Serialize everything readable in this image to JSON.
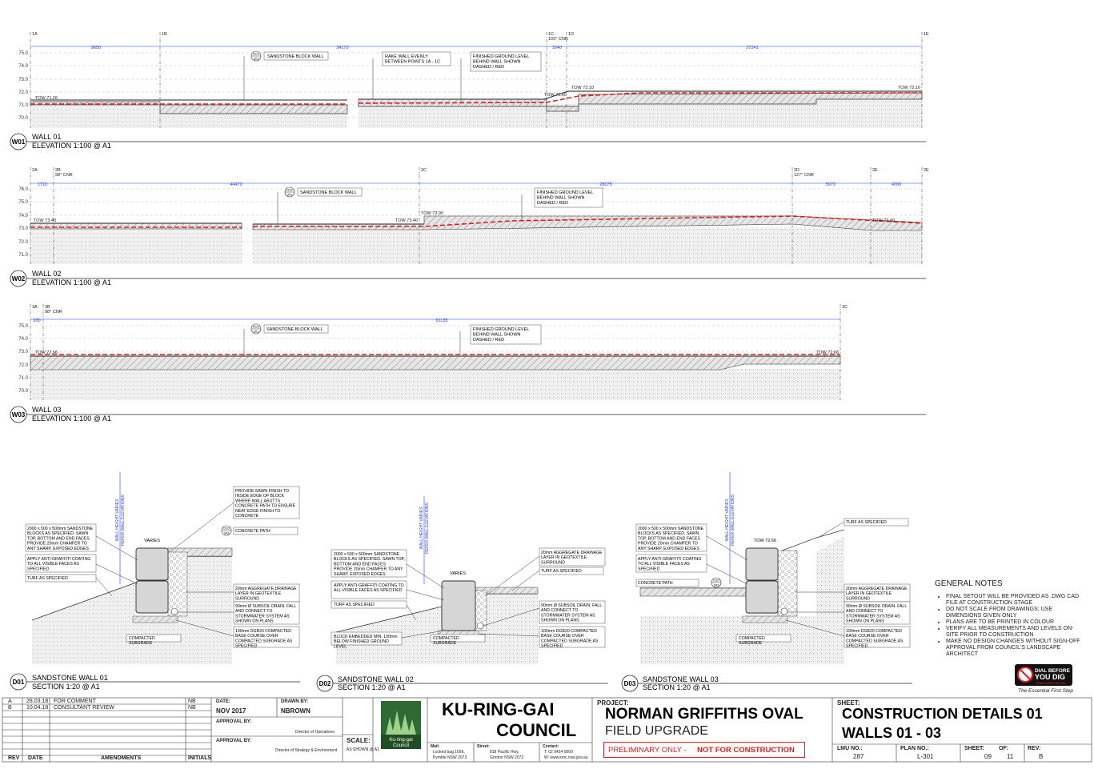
{
  "walls": [
    {
      "tag": "W01",
      "title": "WALL 01",
      "subtitle": "ELEVATION 1:100 @ A1",
      "grid": [
        "1A",
        "1B",
        "1C",
        "1D",
        "1E"
      ],
      "grid_notes": [
        "103° CNR"
      ],
      "dims": [
        "9650",
        "34170",
        "1640",
        "27241"
      ],
      "levels": [
        "75.0",
        "74.0",
        "73.0",
        "72.0",
        "71.0",
        "70.0"
      ],
      "tow": [
        "TOW 71.26",
        "TOW 71.60",
        "TOW 72.10",
        "TOW 72.10"
      ],
      "callout_ref": {
        "top": "D01",
        "bottom": "301"
      },
      "notes": [
        "SANDSTONE BLOCK WALL",
        "RAKE WALL EVENLY BETWEEN POINTS 1A - 1C",
        "FINISHED GROUND LEVEL BEHIND WALL SHOWN DASHED / RED"
      ]
    },
    {
      "tag": "W02",
      "title": "WALL 02",
      "subtitle": "ELEVATION 1:100 @ A1",
      "grid": [
        "2A",
        "2B",
        "2C",
        "2D",
        "2E",
        "2E"
      ],
      "grid_notes": [
        "98° CNR",
        "127° CNR"
      ],
      "dims": [
        "1710",
        "44470",
        "28075",
        "5970",
        "4000"
      ],
      "levels": [
        "76.0",
        "75.0",
        "74.0",
        "73.0",
        "72.0",
        "71.0"
      ],
      "tow": [
        "TOW 73.40",
        "TOW 73.40",
        "TOW 73.90",
        "TOW 73.40"
      ],
      "callout_ref": {
        "top": "D02",
        "bottom": "301"
      },
      "notes": [
        "SANDSTONE BLOCK WALL",
        "FINISHED GROUND LEVEL BEHIND WALL SHOWN DASHED / RED"
      ]
    },
    {
      "tag": "W03",
      "title": "WALL 03",
      "subtitle": "ELEVATION 1:100 @ A1",
      "grid": [
        "3A",
        "3B",
        "3C"
      ],
      "grid_notes": [
        "98° CNR"
      ],
      "dims": [
        "930",
        "61135"
      ],
      "levels": [
        "75.0",
        "74.0",
        "73.0",
        "72.0",
        "71.0",
        "70.0"
      ],
      "tow": [
        "TOW 72.66",
        "TOW 72.66"
      ],
      "callout_ref": {
        "top": "D03",
        "bottom": "301"
      },
      "notes": [
        "SANDSTONE BLOCK WALL",
        "FINISHED GROUND LEVEL BEHIND WALL SHOWN DASHED / RED"
      ]
    }
  ],
  "sections": [
    {
      "tag": "D01",
      "title": "SANDSTONE WALL 01",
      "subtitle": "SECTION 1:20 @ A1",
      "vert_label": [
        "WALL HEIGHT VARIES",
        "REFER WALL ELEVATIONS"
      ],
      "varies": "VARIES",
      "ref": {
        "top": "D10",
        "bottom": "303"
      },
      "left_notes": [
        "2000 x 500 x 500mm SANDSTONE BLOCKS AS SPECIFIED. SAWN TOP, BOTTOM AND END FACES PROVIDE 20mm CHAMFER TO ANY SHARP, EXPOSED EDGES",
        "APPLY ANTI-GRAFFITI COATING TO ALL VISIBLE FACES AS SPECIFIED",
        "TURF AS SPECIFIED"
      ],
      "right_notes": [
        "PROVIDE SAWN FINISH TO INSIDE EDGE OF BLOCK WHERE WALL ABUTTS CONCRETE PATH TO ENSURE NEAT EDGE FINISH TO CONCRETE",
        "CONCRETE PATH",
        "20mm AGGREGATE DRAINAGE LAYER IN GEOTEXTILE SURROUND",
        "90mm Ø SUBSOIL DRAIN. FALL AND CONNECT TO STORMWATER SYSTEM AS SHOWN ON PLANS",
        "100mm DGB20 COMPACTED BASE COURSE OVER COMPACTED SUBGRADE AS SPECIFIED"
      ],
      "bottom_note": "COMPACTED SUBGRADE"
    },
    {
      "tag": "D02",
      "title": "SANDSTONE WALL 02",
      "subtitle": "SECTION 1:20 @ A1",
      "vert_label": [
        "WALL HEIGHT VARIES",
        "REFER WALL ELEVATIONS"
      ],
      "varies": "VARIES",
      "left_notes": [
        "2000 x 500 x 500mm SANDSTONE BLOCKS AS SPECIFIED. SAWN TOP, BOTTOM AND END FACES PROVIDE 20mm CHAMFER TO ANY SHARP, EXPOSED EDGES",
        "APPLY ANTI-GRAFFITI COATING TO ALL VISIBLE FACES AS SPECIFIED",
        "TURF AS SPECIFIED",
        "BLOCK EMBEDDED MIN. 100mm BELOW FINISHED GROUND LEVEL"
      ],
      "right_notes": [
        "20mm AGGREGATE DRAINAGE LAYER IN GEOTEXTILE SURROUND",
        "TURF AS SPECIFIED",
        "90mm Ø SUBSOIL DRAIN. FALL AND CONNECT TO STORMWATER SYSTEM AS SHOWN ON PLANS",
        "100mm DGB20 COMPACTED BASE COURSE OVER COMPACTED SUBGRADE AS SPECIFIED"
      ],
      "bottom_note": "COMPACTED SUBGRADE"
    },
    {
      "tag": "D03",
      "title": "SANDSTONE WALL 03",
      "subtitle": "SECTION 1:20 @ A1",
      "vert_label": [
        "WALL HEIGHT VARIES",
        "REFER WALL ELEVATIONS"
      ],
      "tow": "TOW 72.66",
      "ref": {
        "top": "D10",
        "bottom": "303"
      },
      "left_notes": [
        "2000 x 500 x 500mm SANDSTONE BLOCKS AS SPECIFIED. SAWN TOP, BOTTOM AND END FACES PROVIDE 20mm CHAMFER TO ANY SHARP, EXPOSED EDGES",
        "APPLY ANTI-GRAFFITI COATING TO ALL VISIBLE FACES AS SPECIFIED",
        "CONCRETE PATH"
      ],
      "right_notes": [
        "TURF AS SPECIFIED",
        "20mm AGGREGATE DRAINAGE LAYER IN GEOTEXTILE SURROUND",
        "90mm Ø SUBSOIL DRAIN. FALL AND CONNECT TO STORMWATER SYSTEM AS SHOWN ON PLANS",
        "100mm DGB20 COMPACTED BASE COURSE OVER COMPACTED SUBGRADE AS SPECIFIED"
      ],
      "bottom_note": "COMPACTED SUBGRADE"
    }
  ],
  "general_notes": {
    "title": "GENERAL NOTES",
    "items": [
      "FINAL SETOUT WILL BE PROVIDED AS .DWG CAD FILE AT CONSTRUCTION STAGE",
      "DO NOT SCALE FROM DRAWINGS; USE DIMENSIONS GIVEN ONLY",
      "PLANS ARE TO BE PRINTED IN COLOUR",
      "VERIFY ALL MEASUREMENTS AND LEVELS ON-SITE PRIOR TO CONSTRUCTION",
      "MAKE NO DESIGN CHANGES WITHOUT SIGN-OFF APPROVAL FROM COUNCIL'S LANDSCAPE ARCHITECT"
    ]
  },
  "dial": {
    "line1": "DIAL BEFORE",
    "line2": "YOU DIG",
    "url": "www.1100.com.au",
    "tagline": "The Essential First Step"
  },
  "title_block": {
    "revisions": [
      {
        "rev": "A",
        "date": "28.03.18",
        "text": "FOR COMMENT",
        "init": "NB"
      },
      {
        "rev": "B",
        "date": "10.04.18",
        "text": "CONSULTANT REVIEW",
        "init": "NB"
      }
    ],
    "rev_headers": {
      "rev": "REV",
      "date": "DATE",
      "amend": "AMENDMENTS",
      "init": "INITIALS"
    },
    "date_label": "DATE:",
    "date": "NOV 2017",
    "drawn_label": "DRAWN BY:",
    "drawn": "NBROWN",
    "approval1_label": "APPROVAL BY:",
    "approval1_role": "Director of Operations",
    "approval2_label": "APPROVAL BY:",
    "approval2_role": "Director of Strategy & Environment",
    "scale_label": "SCALE:",
    "scale": "AS SHOWN @ A1",
    "logo_text": [
      "Ku-ring-gai",
      "Council"
    ],
    "council": [
      "KU-RING-GAI",
      "COUNCIL"
    ],
    "mail_label": "Mail:",
    "mail": [
      "Locked bag 1056,",
      "Pymble NSW 2073"
    ],
    "street_label": "Street:",
    "street": [
      "818 Pacific Hwy,",
      "Gordon NSW 2072"
    ],
    "contact_label": "Contact:",
    "contact": [
      "T: 02 9424 0000",
      "W: www.kmc.nsw.gov.au"
    ],
    "project_label": "PROJECT:",
    "project": "NORMAN GRIFFITHS OVAL",
    "project_sub": "FIELD UPGRADE",
    "prelim_a": "PRELIMINARY ONLY -",
    "prelim_b": "NOT FOR CONSTRUCTION",
    "sheet_label": "SHEET:",
    "sheet_title": [
      "CONSTRUCTION DETAILS 01",
      "WALLS 01 - 03"
    ],
    "lmu_label": "LMU NO.:",
    "lmu": "287",
    "plan_label": "PLAN NO.:",
    "plan": "L-301",
    "sheet_no_label": "SHEET:",
    "sheet_no": "09",
    "of_label": "OF:",
    "of": "11",
    "rev_label": "REV:",
    "rev": "B"
  },
  "colors": {
    "dim": "#1f3fff",
    "fgl": "#e11d1d",
    "ink": "#222222"
  }
}
